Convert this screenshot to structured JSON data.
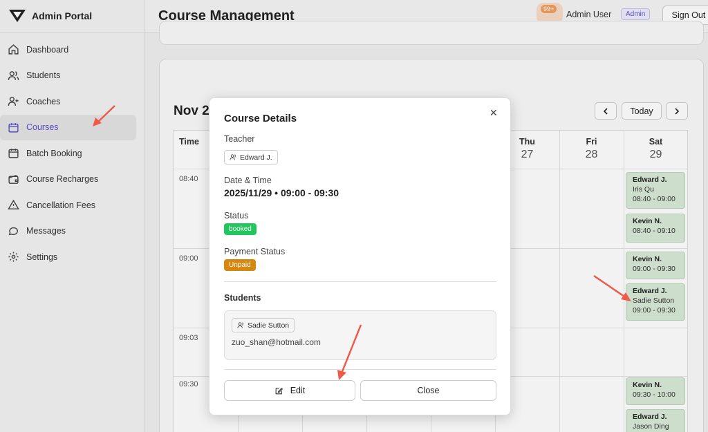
{
  "app": {
    "title": "Admin Portal"
  },
  "sidebar": {
    "items": [
      {
        "label": "Dashboard"
      },
      {
        "label": "Students"
      },
      {
        "label": "Coaches"
      },
      {
        "label": "Courses"
      },
      {
        "label": "Batch Booking"
      },
      {
        "label": "Course Recharges"
      },
      {
        "label": "Cancellation Fees"
      },
      {
        "label": "Messages"
      },
      {
        "label": "Settings"
      }
    ]
  },
  "header": {
    "title": "Course Management",
    "notification_count": "99+",
    "user_name": "Admin User",
    "role_badge": "Admin",
    "sign_out": "Sign Out"
  },
  "calendar": {
    "month_label": "Nov 2",
    "today_label": "Today",
    "prev_icon": "chevron-left-icon",
    "next_icon": "chevron-right-icon",
    "time_header": "Time",
    "days": [
      {
        "name": "Thu",
        "date": "27"
      },
      {
        "name": "Fri",
        "date": "28"
      },
      {
        "name": "Sat",
        "date": "29"
      }
    ],
    "times": [
      "08:40",
      "09:00",
      "09:03",
      "09:30"
    ],
    "events": [
      {
        "teacher": "Edward J.",
        "student": "Iris Qu",
        "time": "08:40 - 09:00"
      },
      {
        "teacher": "Kevin N.",
        "student": "",
        "time": "08:40 - 09:10"
      },
      {
        "teacher": "Kevin N.",
        "student": "",
        "time": "09:00 - 09:30"
      },
      {
        "teacher": "Edward J.",
        "student": "Sadie Sutton",
        "time": "09:00 - 09:30"
      },
      {
        "teacher": "Kevin N.",
        "student": "",
        "time": "09:30 - 10:00"
      },
      {
        "teacher": "Edward J.",
        "student": "Jason Ding",
        "time": ""
      }
    ]
  },
  "modal": {
    "title": "Course Details",
    "teacher_label": "Teacher",
    "teacher_name": "Edward J.",
    "datetime_label": "Date & Time",
    "datetime_value": "2025/11/29 • 09:00 - 09:30",
    "status_label": "Status",
    "status_value": "booked",
    "payment_label": "Payment Status",
    "payment_value": "Unpaid",
    "students_label": "Students",
    "student_name": "Sadie Sutton",
    "student_email": "zuo_shan@hotmail.com",
    "edit_label": "Edit",
    "close_label": "Close"
  },
  "colors": {
    "accent": "#5a4fd0",
    "booked": "#22c55e",
    "unpaid": "#d4880f",
    "event_bg": "#d9ead9",
    "annotation_arrow": "#f05a4a"
  }
}
